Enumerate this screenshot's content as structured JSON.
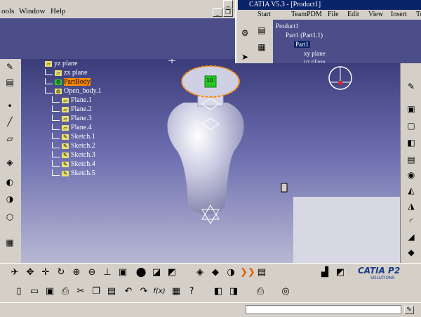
{
  "menubar": {
    "items": [
      "ools",
      "Window",
      "Help"
    ]
  },
  "catia": {
    "title": "CATIA V5.3 - [Product1]",
    "menu": [
      "Start",
      "TeamPDM",
      "File",
      "Edit",
      "View",
      "Insert",
      "To"
    ],
    "tree": [
      "Product1",
      "Part1 (Part1.1)",
      "Part1",
      "xy plane",
      "yz plane"
    ]
  },
  "tree": {
    "items": [
      "yz plane",
      "zx plane",
      "PartBody",
      "Open_body.1",
      "Plane.1",
      "Plane.2",
      "Plane.3",
      "Plane.4",
      "Sketch.1",
      "Sketch.2",
      "Sketch.3",
      "Sketch.4",
      "Sketch.5"
    ]
  },
  "viewport": {
    "label_10": "10"
  },
  "branding": {
    "logo": "CATIA P2",
    "sub": "SOLUTIONS"
  },
  "colors": {
    "viewport_top": "#3a3c7a",
    "viewport_bottom": "#b8b8d4",
    "title_bar": "#0a246a",
    "highlight": "#ff8a00"
  }
}
